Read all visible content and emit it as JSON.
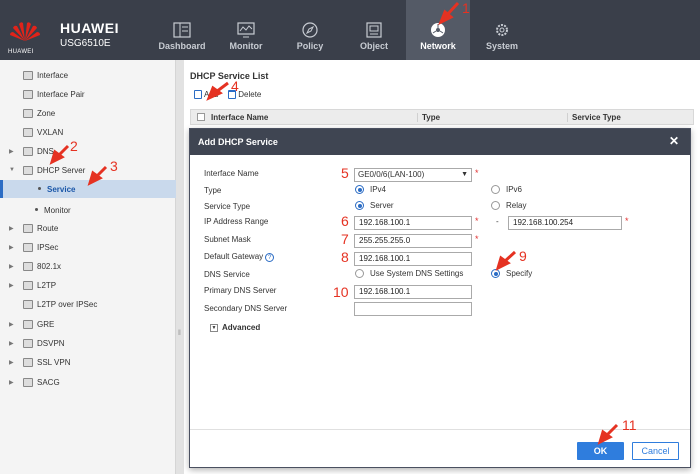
{
  "header": {
    "brand": "HUAWEI",
    "model": "USG6510E",
    "logo_text": "HUAWEI",
    "nav": [
      {
        "label": "Dashboard",
        "icon": "dashboard-icon"
      },
      {
        "label": "Monitor",
        "icon": "monitor-icon"
      },
      {
        "label": "Policy",
        "icon": "policy-icon"
      },
      {
        "label": "Object",
        "icon": "object-icon"
      },
      {
        "label": "Network",
        "icon": "network-icon",
        "active": true
      },
      {
        "label": "System",
        "icon": "gear-icon"
      }
    ]
  },
  "sidebar": {
    "items": [
      {
        "label": "Interface"
      },
      {
        "label": "Interface Pair"
      },
      {
        "label": "Zone"
      },
      {
        "label": "VXLAN"
      },
      {
        "label": "DNS"
      },
      {
        "label": "DHCP Server"
      },
      {
        "label": "Service"
      },
      {
        "label": "Monitor"
      },
      {
        "label": "Route"
      },
      {
        "label": "IPSec"
      },
      {
        "label": "802.1x"
      },
      {
        "label": "L2TP"
      },
      {
        "label": "L2TP over IPSec"
      },
      {
        "label": "GRE"
      },
      {
        "label": "DSVPN"
      },
      {
        "label": "SSL VPN"
      },
      {
        "label": "SACG"
      }
    ]
  },
  "main": {
    "list_title": "DHCP Service List",
    "toolbar": {
      "add": "Add",
      "delete": "Delete"
    },
    "columns": [
      "Interface Name",
      "Type",
      "Service Type"
    ]
  },
  "dialog": {
    "title": "Add DHCP Service",
    "labels": {
      "interface_name": "Interface Name",
      "type": "Type",
      "service_type": "Service Type",
      "ip_range": "IP Address Range",
      "subnet_mask": "Subnet Mask",
      "default_gateway": "Default Gateway",
      "dns_service": "DNS Service",
      "primary_dns": "Primary DNS Server",
      "secondary_dns": "Secondary DNS Server"
    },
    "interface_value": "GE0/0/6(LAN-100)",
    "type_options": [
      "IPv4",
      "IPv6"
    ],
    "service_type_options": [
      "Server",
      "Relay"
    ],
    "ip_range_start": "192.168.100.1",
    "ip_range_sep": "-",
    "ip_range_end": "192.168.100.254",
    "subnet_mask": "255.255.255.0",
    "default_gateway": "192.168.100.1",
    "dns_options": [
      "Use System DNS Settings",
      "Specify"
    ],
    "primary_dns": "192.168.100.1",
    "secondary_dns": "",
    "advanced": "Advanced",
    "ok": "OK",
    "cancel": "Cancel",
    "required_mark": "*",
    "help_mark": "?"
  },
  "annotations": [
    "1",
    "2",
    "3",
    "4",
    "5",
    "6",
    "7",
    "8",
    "9",
    "10",
    "11"
  ],
  "colors": {
    "topbar": "#3a3f4a",
    "accent": "#2f7ddd",
    "annotation": "#e53222",
    "selected": "#c9d9ec"
  }
}
